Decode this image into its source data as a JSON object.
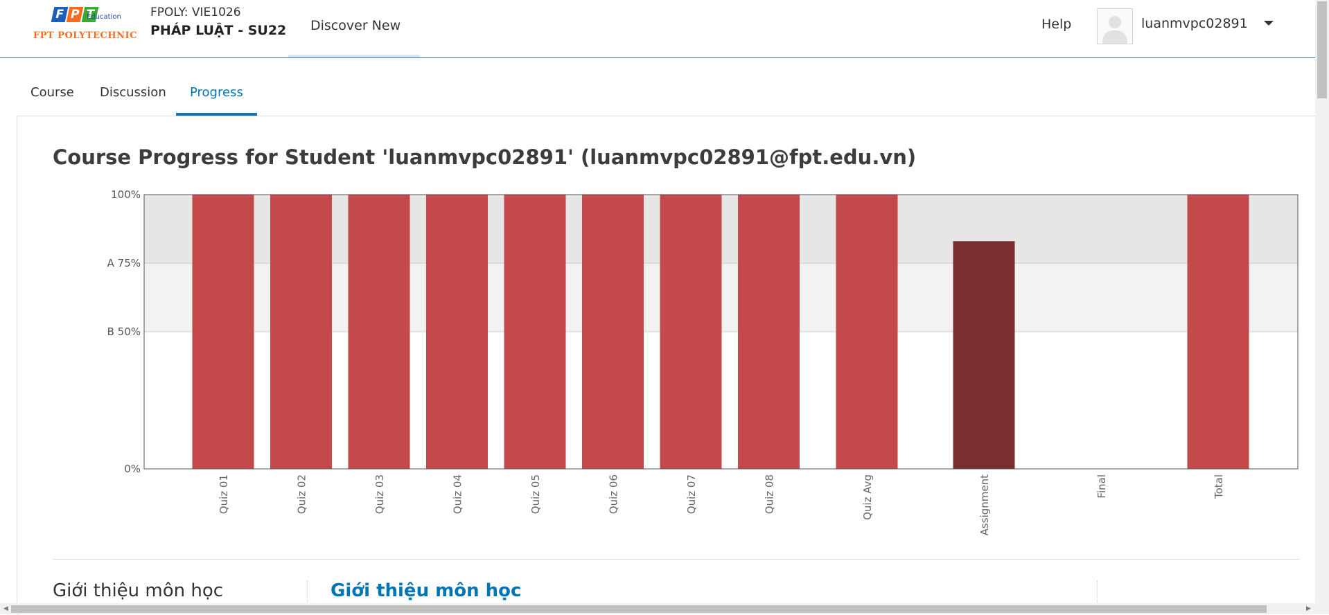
{
  "header": {
    "logo": {
      "letters": [
        "F",
        "P",
        "T"
      ],
      "letter_colors": [
        "#1d5fb8",
        "#f26f21",
        "#3aa935"
      ],
      "edu": "Education",
      "name": "FPT POLYTECHNIC"
    },
    "course_org": "FPOLY: VIE1026",
    "course_name": "PHÁP LUẬT - SU22",
    "discover_label": "Discover New",
    "help_label": "Help",
    "username": "luanmvpc02891"
  },
  "tabs": [
    {
      "label": "Course",
      "active": false
    },
    {
      "label": "Discussion",
      "active": false
    },
    {
      "label": "Progress",
      "active": true
    }
  ],
  "main": {
    "title": "Course Progress for Student 'luanmvpc02891' (luanmvpc02891@fpt.edu.vn)",
    "section_left": "Giới thiệu môn học",
    "section_right": "Giới thiệu môn học"
  },
  "colors": {
    "bar": "#c4494b",
    "bar_dark": "#7a2e2f",
    "band_a": "#e6e6e6",
    "band_b": "#f2f2f2",
    "accent": "#0075b4"
  },
  "chart_data": {
    "type": "bar",
    "categories": [
      "Quiz 01",
      "Quiz 02",
      "Quiz 03",
      "Quiz 04",
      "Quiz 05",
      "Quiz 06",
      "Quiz 07",
      "Quiz 08",
      "Quiz Avg",
      "Assignment",
      "Final",
      "Total"
    ],
    "values": [
      100,
      100,
      100,
      100,
      100,
      100,
      100,
      100,
      100,
      83,
      0,
      100
    ],
    "highlight": [
      "normal",
      "normal",
      "normal",
      "normal",
      "normal",
      "normal",
      "normal",
      "normal",
      "normal",
      "dark",
      "normal",
      "normal"
    ],
    "ylim": [
      0,
      100
    ],
    "yticks": [
      {
        "value": 100,
        "label": "100%"
      },
      {
        "value": 75,
        "label": "A 75%"
      },
      {
        "value": 50,
        "label": "B 50%"
      },
      {
        "value": 0,
        "label": "0%"
      }
    ],
    "grade_bands": [
      {
        "label": "A",
        "from": 75,
        "to": 100
      },
      {
        "label": "B",
        "from": 50,
        "to": 75
      }
    ]
  }
}
